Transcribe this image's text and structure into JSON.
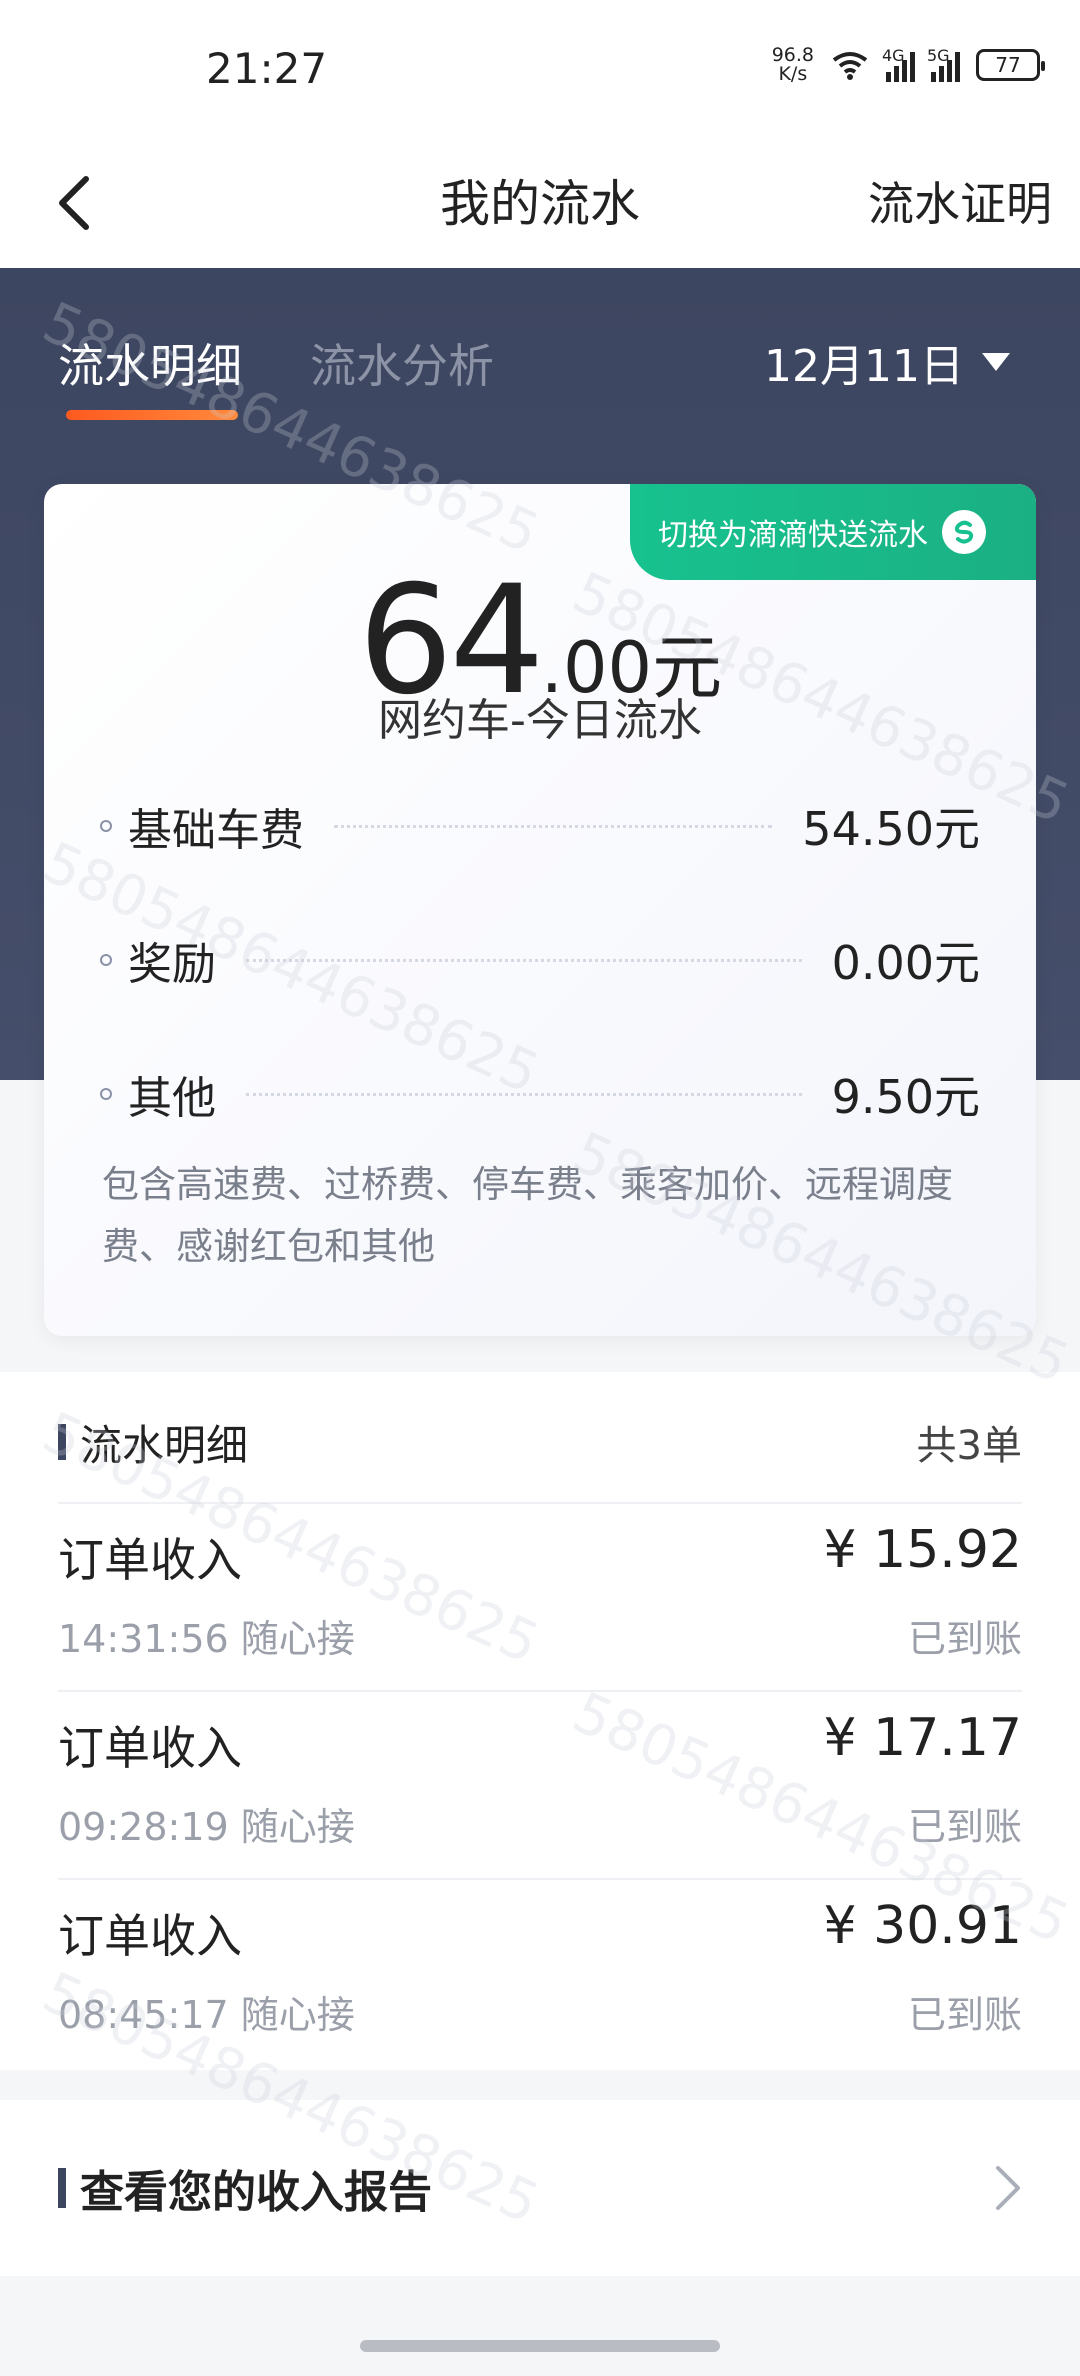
{
  "status_bar": {
    "time": "21:27",
    "net_speed_value": "96.8",
    "net_speed_unit": "K/s",
    "signal_1_label": "4G",
    "signal_2_label": "5G",
    "battery": "77"
  },
  "header": {
    "title": "我的流水",
    "cert_link": "流水证明"
  },
  "tabs": {
    "active": "流水明细",
    "inactive": "流水分析"
  },
  "date_picker": {
    "value": "12月11日"
  },
  "summary": {
    "switch_label": "切换为滴滴快送流水",
    "total_int": "64",
    "total_dec": ".00元",
    "total_label": "网约车-今日流水",
    "items": [
      {
        "label": "基础车费",
        "value": "54.50元"
      },
      {
        "label": "奖励",
        "value": "0.00元"
      },
      {
        "label": "其他",
        "value": "9.50元"
      }
    ],
    "note": "包含高速费、过桥费、停车费、乘客加价、远程调度费、感谢红包和其他"
  },
  "detail": {
    "title": "流水明细",
    "count": "共3单",
    "rows": [
      {
        "title": "订单收入",
        "sub": "14:31:56 随心接",
        "amount": "¥ 15.92",
        "status": "已到账"
      },
      {
        "title": "订单收入",
        "sub": "09:28:19 随心接",
        "amount": "¥ 17.17",
        "status": "已到账"
      },
      {
        "title": "订单收入",
        "sub": "08:45:17 随心接",
        "amount": "¥ 30.91",
        "status": "已到账"
      }
    ]
  },
  "report": {
    "title": "查看您的收入报告"
  },
  "watermark": "5805486446386​25"
}
